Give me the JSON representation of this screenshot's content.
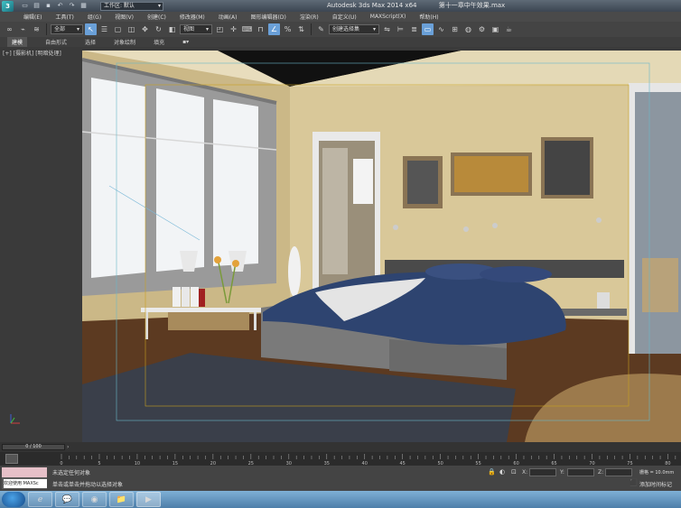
{
  "titlebar": {
    "workspace_label": "工作区: 默认",
    "app_title": "Autodesk 3ds Max  2014 x64",
    "file_title": "第十一章中午效果.max"
  },
  "menu": [
    "编辑(E)",
    "工具(T)",
    "组(G)",
    "视图(V)",
    "创建(C)",
    "修改器(M)",
    "动画(A)",
    "图形编辑器(D)",
    "渲染(R)",
    "自定义(U)",
    "MAXScript(X)",
    "帮助(H)"
  ],
  "toolbar": {
    "filter_value": "全部",
    "refcoord_value": "视图",
    "selset_value": "创建选择集"
  },
  "ribbon": {
    "tabs": [
      "建模",
      "自由形式",
      "选择",
      "对象绘制",
      "填充"
    ],
    "active": "建模"
  },
  "viewport": {
    "label": "[+] [摄影机] [明暗处理]"
  },
  "timeline": {
    "frame_display": "0 / 100",
    "ticks": [
      "0",
      "5",
      "10",
      "15",
      "20",
      "25",
      "30",
      "35",
      "40",
      "45",
      "50",
      "55",
      "60",
      "65",
      "70",
      "75",
      "80",
      "85"
    ]
  },
  "status": {
    "left_label": "欢迎使用 MAXSc",
    "message_top": "未选定任何对象",
    "message_bottom": "单击或单击并拖动以选择对象",
    "x_label": "X:",
    "y_label": "Y:",
    "z_label": "Z:",
    "grid_text": "栅格 = 10.0mm",
    "add_time_tag": "添加时间标记"
  },
  "taskbar": {
    "apps": [
      "ie-icon",
      "wechat-icon",
      "360-icon",
      "folder-icon",
      "3dsmax-icon"
    ]
  },
  "colors": {
    "wall": "#d8c89a",
    "floor": "#5a3a20",
    "bedspread": "#2e4470",
    "accent": "#6aa0d8"
  }
}
